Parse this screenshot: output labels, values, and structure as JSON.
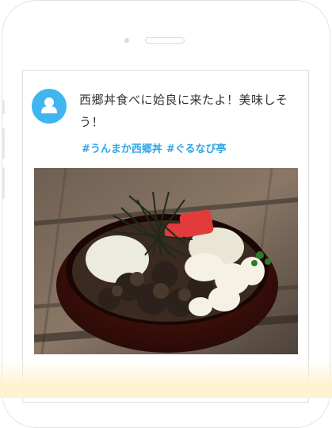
{
  "post": {
    "text": "西郷丼食べに姶良に来たよ！美味しそう！",
    "hashtags": [
      "#うんまか西郷丼",
      "#ぐるなび亭"
    ]
  },
  "icons": {
    "avatar": "user-avatar-icon",
    "camera": "front-camera-icon",
    "speaker": "earpiece-speaker-icon"
  },
  "colors": {
    "avatar_bg": "#3fb6f0",
    "hashtag": "#2ea6e6",
    "fade": "#fff3cf"
  }
}
